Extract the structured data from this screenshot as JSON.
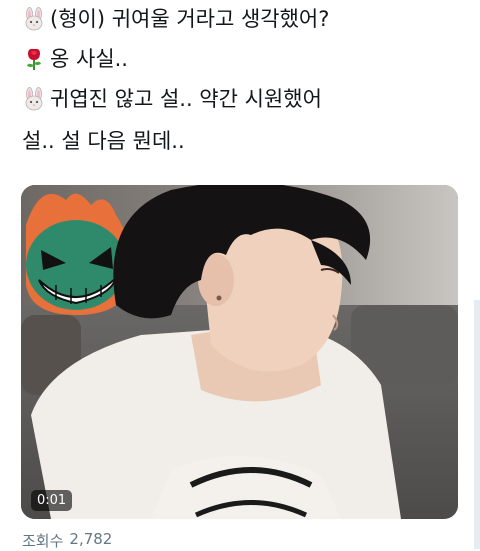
{
  "tweet": {
    "lines": [
      {
        "emoji": "rabbit-face-icon",
        "text": "(형이) 귀여울 거라고 생각했어?"
      },
      {
        "emoji": "rose-icon",
        "text": "옹 사실.."
      },
      {
        "emoji": "rabbit-face-icon",
        "text": "귀엽진 않고 설.. 약간 시원했어"
      },
      {
        "text": "설.. 설 다음 뭔데.."
      }
    ]
  },
  "video": {
    "duration": "0:01"
  },
  "stats": {
    "views_label": "조회수",
    "views_count": "2,782"
  },
  "colors": {
    "text": "#14171a",
    "secondary": "#657786",
    "rose": "#c8102e"
  }
}
